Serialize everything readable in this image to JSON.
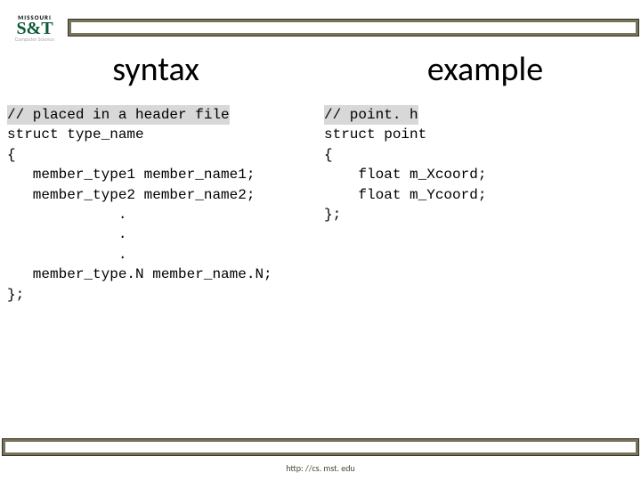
{
  "logo": {
    "top_text": "MISSOURI",
    "main_text": "S&T",
    "sub_text": "Computer Science"
  },
  "headings": {
    "left": "syntax",
    "right": "example"
  },
  "code": {
    "left_highlight": "// placed in a header file",
    "left_body": "struct type_name\n{\n   member_type1 member_name1;\n   member_type2 member_name2;\n             .\n             .\n             .\n   member_type.N member_name.N;\n};",
    "right_highlight": "// point. h",
    "right_body": "struct point\n{\n    float m_Xcoord;\n    float m_Ycoord;\n};"
  },
  "footer": {
    "url": "http: //cs. mst. edu"
  }
}
